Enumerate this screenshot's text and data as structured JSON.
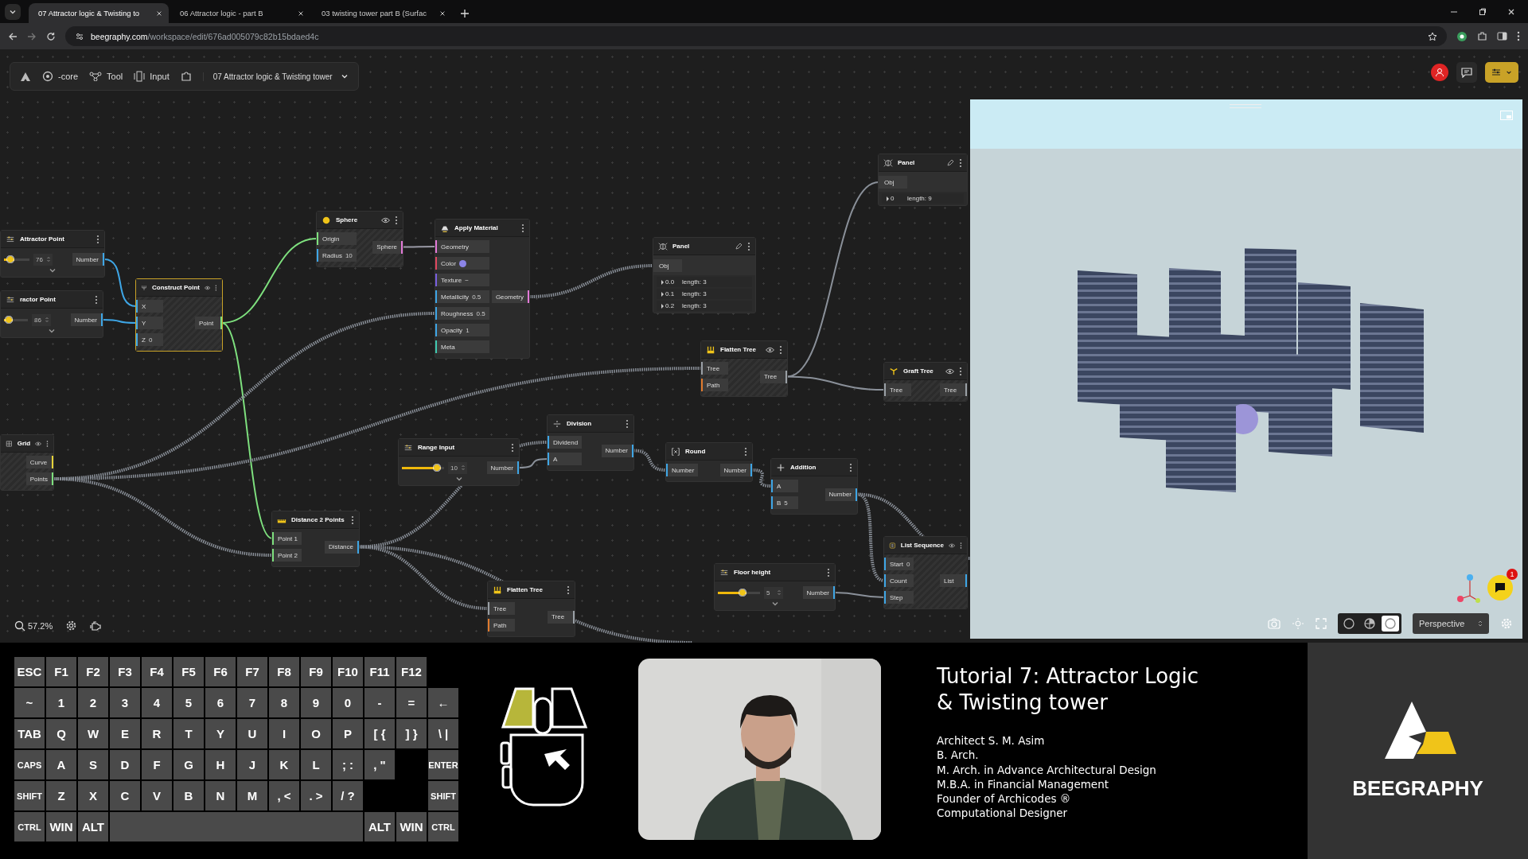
{
  "browser": {
    "tabs": [
      {
        "title": "07 Attractor logic & Twisting to",
        "selected": true
      },
      {
        "title": "06 Attractor logic - part B",
        "selected": false
      },
      {
        "title": "03 twisting tower part B (Surfac",
        "selected": false
      }
    ],
    "url": {
      "host": "beegraphy.com",
      "path": "/workspace/edit/676ad005079c82b15bdaed4c"
    }
  },
  "toolbar": {
    "items": [
      "-core",
      "Tool",
      "Input"
    ],
    "project": "07 Attractor logic & Twisting tower"
  },
  "canvas": {
    "zoom": "57.2%",
    "nodes": [
      {
        "kind": "panel",
        "title": "Panel",
        "selected": false,
        "input": "Obj",
        "rows": [
          {
            "index": "0",
            "text": "length: 9"
          }
        ]
      },
      {
        "kind": "op",
        "title": "Sphere",
        "selected": false,
        "preview": true,
        "inputs": [
          {
            "label": "Origin",
            "color": "#7ee07e"
          },
          {
            "label": "Radius",
            "value": "10",
            "color": "#3ea6e6"
          }
        ],
        "outputs": [
          {
            "label": "Sphere",
            "color": "#e37ad8"
          }
        ]
      },
      {
        "kind": "op",
        "title": "Apply Material",
        "selected": false,
        "preview": false,
        "inputs": [
          {
            "label": "Geometry",
            "color": "#e37ad8"
          },
          {
            "label": "Color",
            "swatch": {
              "color": "#8c85e8"
            },
            "color": "#e0475f"
          },
          {
            "label": "Texture",
            "value": "−",
            "color": "#7a5fe0"
          },
          {
            "label": "Metallicity",
            "value": "0.5",
            "color": "#3ea6e6"
          },
          {
            "label": "Roughness",
            "value": "0.5",
            "color": "#3ea6e6"
          },
          {
            "label": "Opacity",
            "value": "1",
            "color": "#3ea6e6"
          },
          {
            "label": "Meta",
            "color": "#3fc9b0"
          }
        ],
        "outputs": [
          {
            "label": "Geometry",
            "color": "#e37ad8"
          }
        ]
      },
      {
        "kind": "slider",
        "title": "Attractor Point",
        "selected": false,
        "level": 0.4,
        "value": "76",
        "output": {
          "label": "Number",
          "color": "#3ea6e6"
        }
      },
      {
        "kind": "panel",
        "title": "Panel",
        "selected": false,
        "input": "Obj",
        "rows": [
          {
            "index": "0.0",
            "text": "length: 3"
          },
          {
            "index": "0.1",
            "text": "length: 3"
          },
          {
            "index": "0.2",
            "text": "length: 3"
          }
        ]
      },
      {
        "kind": "op",
        "title": "Construct Point",
        "selected": true,
        "preview": true,
        "inputs": [
          {
            "label": "X",
            "color": "#3ea6e6"
          },
          {
            "label": "Y",
            "color": "#3ea6e6"
          },
          {
            "label": "Z",
            "value": "0",
            "color": "#3ea6e6"
          }
        ],
        "outputs": [
          {
            "label": "Point",
            "color": "#7ee07e"
          }
        ]
      },
      {
        "kind": "slider",
        "title": "ractor Point",
        "selected": false,
        "level": 0.35,
        "value": "86",
        "output": {
          "label": "Number",
          "color": "#3ea6e6"
        }
      },
      {
        "kind": "op",
        "title": "Flatten Tree",
        "selected": false,
        "preview": true,
        "inputs": [
          {
            "label": "Tree",
            "color": "#9aa0a6"
          },
          {
            "label": "Path",
            "color": "#e07a2e"
          }
        ],
        "outputs": [
          {
            "label": "Tree",
            "color": "#9aa0a6"
          }
        ]
      },
      {
        "kind": "op",
        "title": "Graft Tree",
        "selected": false,
        "preview": true,
        "inputs": [
          {
            "label": "Tree",
            "color": "#9aa0a6"
          }
        ],
        "outputs": [
          {
            "label": "Tree",
            "color": "#9aa0a6"
          }
        ]
      },
      {
        "kind": "op",
        "title": "Division",
        "selected": false,
        "preview": false,
        "inputs": [
          {
            "label": "Dividend",
            "color": "#3ea6e6"
          },
          {
            "label": "A",
            "color": "#3ea6e6"
          }
        ],
        "outputs": [
          {
            "label": "Number",
            "color": "#3ea6e6"
          }
        ]
      },
      {
        "kind": "op",
        "title": "Grid",
        "selected": false,
        "preview": true,
        "outputs": [
          {
            "label": "Curve",
            "color": "#e5d33a"
          },
          {
            "label": "Points",
            "color": "#7ee07e"
          }
        ]
      },
      {
        "kind": "slider",
        "title": "Range Input",
        "selected": false,
        "level": 0.92,
        "value": "10",
        "output": {
          "label": "Number",
          "color": "#3ea6e6"
        }
      },
      {
        "kind": "op",
        "title": "Round",
        "selected": false,
        "preview": false,
        "inputs": [
          {
            "label": "Number",
            "color": "#3ea6e6"
          }
        ],
        "outputs": [
          {
            "label": "Number",
            "color": "#3ea6e6"
          }
        ]
      },
      {
        "kind": "op",
        "title": "Addition",
        "selected": false,
        "preview": false,
        "inputs": [
          {
            "label": "A",
            "color": "#3ea6e6"
          },
          {
            "label": "B",
            "value": "5",
            "color": "#3ea6e6"
          }
        ],
        "outputs": [
          {
            "label": "Number",
            "color": "#3ea6e6"
          }
        ]
      },
      {
        "kind": "op",
        "title": "Distance 2 Points",
        "selected": false,
        "preview": false,
        "inputs": [
          {
            "label": "Point 1",
            "color": "#7ee07e"
          },
          {
            "label": "Point 2",
            "color": "#7ee07e"
          }
        ],
        "outputs": [
          {
            "label": "Distance",
            "color": "#3ea6e6"
          }
        ]
      },
      {
        "kind": "op",
        "title": "List Sequence",
        "selected": false,
        "preview": true,
        "inputs": [
          {
            "label": "Start",
            "value": "0",
            "color": "#3ea6e6"
          },
          {
            "label": "Count",
            "color": "#3ea6e6"
          },
          {
            "label": "Step",
            "color": "#3ea6e6"
          }
        ],
        "outputs": [
          {
            "label": "List",
            "color": "#3ea6e6"
          }
        ]
      },
      {
        "kind": "slider",
        "title": "Floor height",
        "selected": false,
        "level": 0.67,
        "value": "5",
        "output": {
          "label": "Number",
          "color": "#3ea6e6"
        }
      },
      {
        "kind": "op",
        "title": "Flatten Tree",
        "selected": false,
        "preview": false,
        "inputs": [
          {
            "label": "Tree",
            "color": "#9aa0a6"
          },
          {
            "label": "Path",
            "color": "#e07a2e"
          }
        ],
        "outputs": [
          {
            "label": "Tree",
            "color": "#9aa0a6"
          }
        ]
      }
    ]
  },
  "viewport": {
    "notifications": "1",
    "shading_modes": [
      {
        "selected": false
      },
      {
        "selected": false
      },
      {
        "selected": true
      }
    ],
    "camera": "Perspective"
  },
  "keyboard": {
    "rows": [
      [
        {
          "label": "ESC"
        },
        {
          "label": "F1"
        },
        {
          "label": "F2"
        },
        {
          "label": "F3"
        },
        {
          "label": "F4"
        },
        {
          "label": "F5"
        },
        {
          "label": "F6"
        },
        {
          "label": "F7"
        },
        {
          "label": "F8"
        },
        {
          "label": "F9"
        },
        {
          "label": "F10"
        },
        {
          "label": "F11"
        },
        {
          "label": "F12"
        }
      ],
      [
        {
          "label": "~"
        },
        {
          "label": "1"
        },
        {
          "label": "2"
        },
        {
          "label": "3"
        },
        {
          "label": "4"
        },
        {
          "label": "5"
        },
        {
          "label": "6"
        },
        {
          "label": "7"
        },
        {
          "label": "8"
        },
        {
          "label": "9"
        },
        {
          "label": "0"
        },
        {
          "label": "-"
        },
        {
          "label": "="
        },
        {
          "label": "←"
        }
      ],
      [
        {
          "label": "TAB"
        },
        {
          "label": "Q"
        },
        {
          "label": "W"
        },
        {
          "label": "E"
        },
        {
          "label": "R"
        },
        {
          "label": "T"
        },
        {
          "label": "Y"
        },
        {
          "label": "U"
        },
        {
          "label": "I"
        },
        {
          "label": "O"
        },
        {
          "label": "P"
        },
        {
          "label": "[ {"
        },
        {
          "label": "] }"
        },
        {
          "label": "\\ |"
        }
      ],
      [
        {
          "label": "CAPS"
        },
        {
          "label": "A"
        },
        {
          "label": "S"
        },
        {
          "label": "D"
        },
        {
          "label": "F"
        },
        {
          "label": "G"
        },
        {
          "label": "H"
        },
        {
          "label": "J"
        },
        {
          "label": "K"
        },
        {
          "label": "L"
        },
        {
          "label": "; :"
        },
        {
          "label": ", \""
        },
        {
          "kind": "gap"
        },
        {
          "label": "ENTER"
        }
      ],
      [
        {
          "label": "SHIFT"
        },
        {
          "label": "Z"
        },
        {
          "label": "X"
        },
        {
          "label": "C"
        },
        {
          "label": "V"
        },
        {
          "label": "B"
        },
        {
          "label": "N"
        },
        {
          "label": "M"
        },
        {
          "label": ", <"
        },
        {
          "label": ". >"
        },
        {
          "label": "/ ?"
        },
        {
          "kind": "gap"
        },
        {
          "kind": "gap"
        },
        {
          "label": "SHIFT"
        }
      ],
      [
        {
          "label": "CTRL"
        },
        {
          "label": "WIN"
        },
        {
          "label": "ALT"
        },
        {
          "kind": "space"
        },
        {
          "kind": "gap"
        },
        {
          "kind": "gap"
        },
        {
          "kind": "gap"
        },
        {
          "kind": "gap"
        },
        {
          "kind": "gap"
        },
        {
          "kind": "gap"
        },
        {
          "kind": "gap"
        },
        {
          "label": "ALT"
        },
        {
          "label": "WIN"
        },
        {
          "label": "CTRL"
        }
      ]
    ]
  },
  "tutorial": {
    "title": "Tutorial 7: Attractor Logic & Twisting tower",
    "credits": [
      "Architect S. M. Asim",
      "B. Arch.",
      "M. Arch. in Advance Architectural Design",
      "M.B.A. in Financial Management",
      "Founder of Archicodes ®",
      "Computational Designer"
    ],
    "brand": "BEEGRAPHY"
  }
}
